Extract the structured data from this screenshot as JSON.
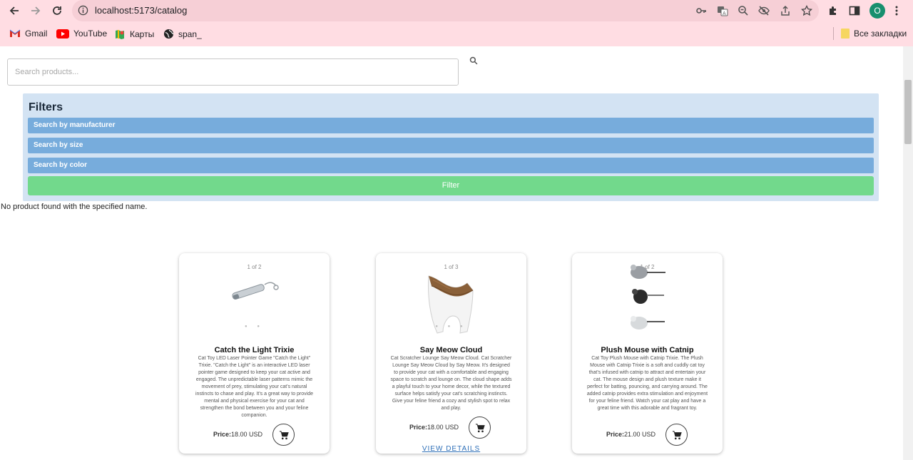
{
  "browser": {
    "url": "localhost:5173/catalog",
    "avatar_letter": "O",
    "bookmarks": [
      {
        "label": "Gmail",
        "icon": "gmail-icon"
      },
      {
        "label": "YouTube",
        "icon": "youtube-icon"
      },
      {
        "label": "Карты",
        "icon": "maps-icon"
      },
      {
        "label": "span_",
        "icon": "globe-icon"
      }
    ],
    "all_bookmarks_label": "Все закладки"
  },
  "search": {
    "placeholder": "Search products..."
  },
  "filters": {
    "title": "Filters",
    "manufacturer_label": "Search by manufacturer",
    "size_label": "Search by size",
    "color_label": "Search by color",
    "filter_button": "Filter"
  },
  "message": "No product found with the specified name.",
  "products": [
    {
      "counter": "1 of 2",
      "title": "Catch the Light Trixie",
      "description": "Cat Toy LED Laser Pointer Game \"Catch the Light\" Trixie. \"Catch the Light\" is an interactive LED laser pointer game designed to keep your cat active and engaged. The unpredictable laser patterns mimic the movement of prey, stimulating your cat's natural instincts to chase and play. It's a great way to provide mental and physical exercise for your cat and strengthen the bond between you and your feline companion.",
      "price_label": "Price:",
      "price_value": "18.00 USD"
    },
    {
      "counter": "1 of 3",
      "title": "Say Meow Cloud",
      "description": "Cat Scratcher Lounge Say Meow Cloud. Cat Scratcher Lounge Say Meow Cloud by Say Meow. It's designed to provide your cat with a comfortable and engaging space to scratch and lounge on. The cloud shape adds a playful touch to your home decor, while the textured surface helps satisfy your cat's scratching instincts. Give your feline friend a cozy and stylish spot to relax and play.",
      "price_label": "Price:",
      "price_value": "18.00 USD",
      "details_link": "VIEW DETAILS"
    },
    {
      "counter": "1 of 2",
      "title": "Plush Mouse with Catnip",
      "description": "Cat Toy Plush Mouse with Catnip Trixie. The Plush Mouse with Catnip Trixie is a soft and cuddly cat toy that's infused with catnip to attract and entertain your cat. The mouse design and plush texture make it perfect for batting, pouncing, and carrying around. The added catnip provides extra stimulation and enjoyment for your feline friend. Watch your cat play and have a great time with this adorable and fragrant toy.",
      "price_label": "Price:",
      "price_value": "21.00 USD"
    }
  ],
  "colors": {
    "chrome_bg": "#ffdde3",
    "filters_bg": "#d3e3f3",
    "filter_row": "#77acdc",
    "filter_button": "#72d98c"
  }
}
